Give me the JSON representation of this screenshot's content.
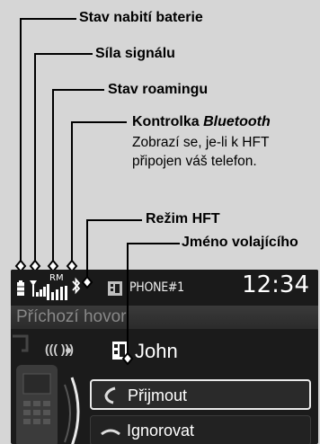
{
  "annotations": {
    "battery": "Stav nabití baterie",
    "signal": "Síla signálu",
    "roaming": "Stav roamingu",
    "bluetooth_title_prefix": "Kontrolka ",
    "bluetooth_title_italic": "Bluetooth",
    "bluetooth_desc_line1": "Zobrazí se, je-li k HFT",
    "bluetooth_desc_line2": "připojen váš telefon.",
    "hft_mode": "Režim HFT",
    "caller_name_label": "Jméno volajícího"
  },
  "status_bar": {
    "roaming_text": "RM",
    "device_name": "PHONE#1",
    "clock": "12:34"
  },
  "call_screen": {
    "header": "Příchozí hovor",
    "caller": "John",
    "accept_label": "Přijmout",
    "ignore_label": "Ignorovat"
  },
  "icons": [
    "battery-icon",
    "signal-strength-icon",
    "roaming-icon",
    "bluetooth-icon",
    "hft-mode-icon",
    "phone-handset-icon",
    "ringing-waves-icon",
    "contact-card-icon",
    "accept-call-icon",
    "ignore-call-icon"
  ]
}
